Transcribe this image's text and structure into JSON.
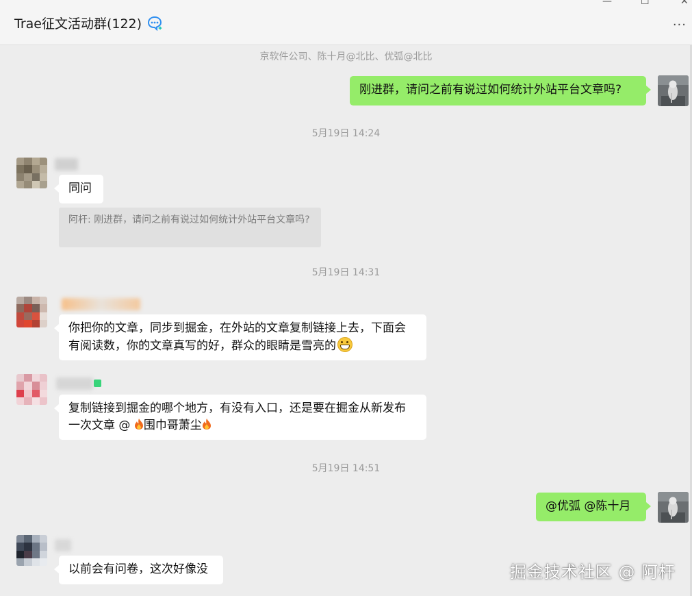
{
  "header": {
    "title": "Trae征文活动群(122)",
    "more_label": "···",
    "minimize_label": "—",
    "maximize_label": "☐",
    "close_label": "✕"
  },
  "messages": {
    "system_note": "京软件公司、陈十月@北比、优弧@北比",
    "m1": {
      "text": "刚进群，请问之前有说过如何统计外站平台文章吗?"
    },
    "t1": "5月19日 14:24",
    "m2": {
      "text": "同问",
      "quote": "阿杆: 刚进群，请问之前有说过如何统计外站平台文章吗?"
    },
    "t2": "5月19日 14:31",
    "m3": {
      "line1": "你把你的文章，同步到掘金，在外站的文章复制链接上去，下面会",
      "line2": "有阅读数，你的文章真写的好，群众的眼睛是雪亮的"
    },
    "m4": {
      "line1": "复制链接到掘金的哪个地方，有没有入口，还是要在掘金从新发布",
      "line2_a": "一次文章 @",
      "line2_b": "围巾哥萧尘"
    },
    "t3": "5月19日 14:51",
    "m5": {
      "text": "@优弧 @陈十月"
    },
    "m6": {
      "text": "以前会有问卷，这次好像没"
    }
  },
  "watermark": "掘金技术社区 @ 阿杆",
  "colors": {
    "self_bubble": "#95ec69",
    "other_bubble": "#ffffff",
    "background": "#ededed"
  }
}
